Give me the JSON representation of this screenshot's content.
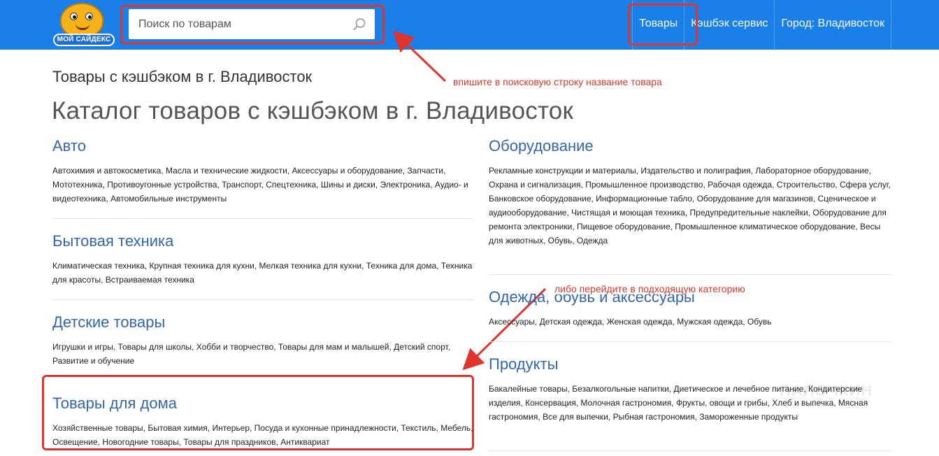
{
  "header": {
    "logo_text": "МОЙ САЙДЕКС",
    "search": {
      "placeholder": "Поиск по товарам",
      "value": ""
    },
    "nav": [
      {
        "label": "Товары"
      },
      {
        "label": "Кэшбэк сервис"
      },
      {
        "label": "Город: Владивосток"
      }
    ]
  },
  "page": {
    "subtitle": "Товары с кэшбэком в г. Владивосток",
    "title": "Каталог товаров с кэшбэком в г. Владивосток"
  },
  "annotations": {
    "search_hint": "впишите в поисковую строку название товара",
    "category_hint": "либо перейдите в подходящую категорию"
  },
  "categories_left": [
    {
      "title": "Авто",
      "links": [
        "Автохимия и автокосметика",
        "Масла и технические жидкости",
        "Аксессуары и оборудование",
        "Запчасти",
        "Мототехника",
        "Противоугонные устройства",
        "Транспорт",
        "Спецтехника",
        "Шины и диски",
        "Электроника",
        "Аудио- и видеотехника",
        "Автомобильные инструменты"
      ]
    },
    {
      "title": "Бытовая техника",
      "links": [
        "Климатическая техника",
        "Крупная техника для кухни",
        "Мелкая техника для кухни",
        "Техника для дома",
        "Техника для красоты",
        "Встраиваемая техника"
      ]
    },
    {
      "title": "Детские товары",
      "links": [
        "Игрушки и игры",
        "Товары для школы",
        "Хобби и творчество",
        "Товары для мам и малышей",
        "Детский спорт",
        "Развитие и обучение"
      ]
    },
    {
      "title": "Товары для дома",
      "links": [
        "Хозяйственные товары",
        "Бытовая химия",
        "Интерьер",
        "Посуда и кухонные принадлежности",
        "Текстиль",
        "Мебель",
        "Освещение",
        "Новогодние товары",
        "Товары для праздников",
        "Антиквариат"
      ]
    }
  ],
  "categories_right": [
    {
      "title": "Оборудование",
      "links": [
        "Рекламные конструкции и материалы",
        "Издательство и полиграфия",
        "Лабораторное оборудование",
        "Охрана и сигнализация",
        "Промышленное производство",
        "Рабочая одежда",
        "Строительство",
        "Сфера услуг",
        "Банковское оборудование",
        "Информационные табло",
        "Оборудование для магазинов",
        "Сценическое и аудиооборудование",
        "Чистящая и моющая техника",
        "Предупредительные наклейки",
        "Оборудование для ремонта электроники",
        "Пищевое оборудование",
        "Промышленное климатическое оборудование",
        "Весы для животных",
        "Обувь",
        "Одежда"
      ]
    },
    {
      "title": "Одежда, обувь и аксессуары",
      "links": [
        "Аксессуары",
        "Детская одежда",
        "Женская одежда",
        "Мужская одежда",
        "Обувь"
      ]
    },
    {
      "title": "Продукты",
      "links": [
        "Бакалейные товары",
        "Безалкогольные напитки",
        "Диетическое и лечебное питание",
        "Кондитерские изделия",
        "Консервация",
        "Молочная гастрономия",
        "Фрукты, овощи и грибы",
        "Хлеб и выпечка",
        "Мясная гастрономия",
        "Все для выпечки",
        "Рыбная гастрономия",
        "Замороженные продукты"
      ]
    }
  ],
  "watermark": "ПАЛОЧКИН",
  "colors": {
    "header_bg": "#1a7fe6",
    "category_title": "#3366aa",
    "annotation_red": "#e0342f"
  },
  "icons": {
    "search": "search-icon",
    "logo": "mascot-logo-icon"
  }
}
